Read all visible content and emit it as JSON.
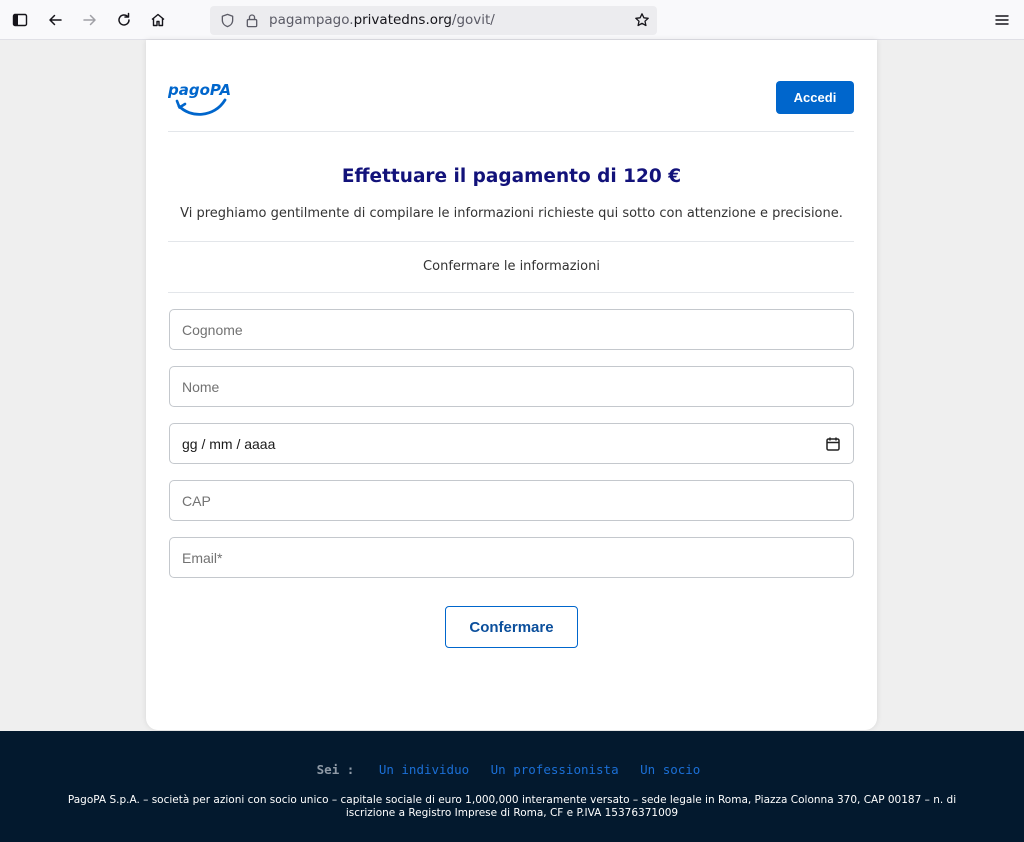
{
  "browser": {
    "url_prefix": "pagampago.",
    "url_domain": "privatedns.org",
    "url_path": "/govit/"
  },
  "header": {
    "logo_text": "pagoPA",
    "login_label": "Accedi"
  },
  "main": {
    "title": "Effettuare il pagamento di 120 €",
    "subtitle": "Vi preghiamo gentilmente di compilare le informazioni richieste qui sotto con attenzione e precisione.",
    "section_title": "Confermare le informazioni"
  },
  "form": {
    "surname_placeholder": "Cognome",
    "name_placeholder": "Nome",
    "date_placeholder": "gg / mm / aaaa",
    "cap_placeholder": "CAP",
    "email_placeholder": "Email*",
    "submit_label": "Confermare"
  },
  "footer": {
    "sei_label": "Sei :",
    "links": [
      "Un individuo",
      "Un professionista",
      "Un socio"
    ],
    "legal_line1": "PagoPA S.p.A. – società per azioni con socio unico – capitale sociale di euro 1,000,000 interamente versato – sede legale in Roma, Piazza Colonna 370, CAP 00187 – n. di",
    "legal_line2": "iscrizione a Registro Imprese di Roma, CF e P.IVA 15376371009"
  },
  "colors": {
    "brand_blue": "#0066cc",
    "title_navy": "#12127a",
    "footer_bg": "#03192e"
  }
}
